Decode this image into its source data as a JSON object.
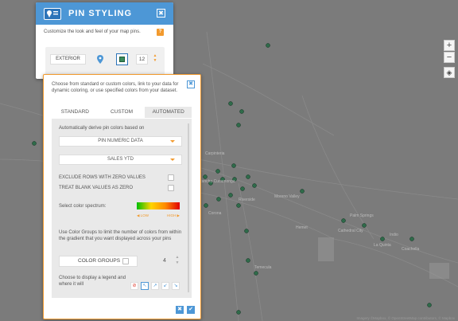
{
  "panel": {
    "title": "PIN STYLING",
    "close_icon": "✖",
    "subtitle": "Customize the look and feel of your map pins.",
    "help_badge": "?",
    "exterior_label": "EXTERIOR",
    "size_value": "12",
    "stepper_up": "▲",
    "stepper_down": "▼"
  },
  "popup": {
    "description": "Choose from standard or custom colors, link to your data for dynamic coloring, or use specified colors from your dataset.",
    "close_icon": "✖",
    "tabs": [
      "STANDARD",
      "CUSTOM",
      "AUTOMATED"
    ],
    "active_tab": "AUTOMATED",
    "auto_label": "Automatically derive pin colors based on",
    "dropdown_1": "PIN NUMERIC DATA",
    "dropdown_2": "SALES YTD",
    "exclude_label": "EXCLUDE ROWS WITH ZERO VALUES",
    "treat_blank_label": "TREAT BLANK VALUES AS ZERO",
    "spectrum_label": "Select color spectrum:",
    "low_label": "◀ LOW",
    "high_label": "HIGH ▶",
    "groups_text": "Use Color Groups to limit the number of colors from within the gradient that you want displayed across your pins",
    "groups_label": "COLOR GROUPS",
    "groups_value": "4",
    "legend_text": "Choose to display a legend and where it will",
    "legend_positions": [
      "⊘",
      "↖",
      "↗",
      "↙",
      "↘"
    ],
    "cancel_icon": "✖",
    "ok_icon": "✔"
  },
  "map": {
    "zoom_in": "+",
    "zoom_out": "−",
    "locate_icon": "◈",
    "credit": "Imagery ©Mapbox, © OpenStreetMap contributors, © Mapbox",
    "labels": [
      "Carpinteria",
      "Rancho Cucamonga",
      "Corona",
      "Riverside",
      "Moreno Valley",
      "Hemet",
      "Temecula",
      "Palm Springs",
      "Cathedral City",
      "Coachella",
      "La Quinta",
      "Indio"
    ],
    "colors": {
      "accent": "#4d97d6",
      "orange": "#f29a2e",
      "pin": "#2f6b4a"
    }
  }
}
